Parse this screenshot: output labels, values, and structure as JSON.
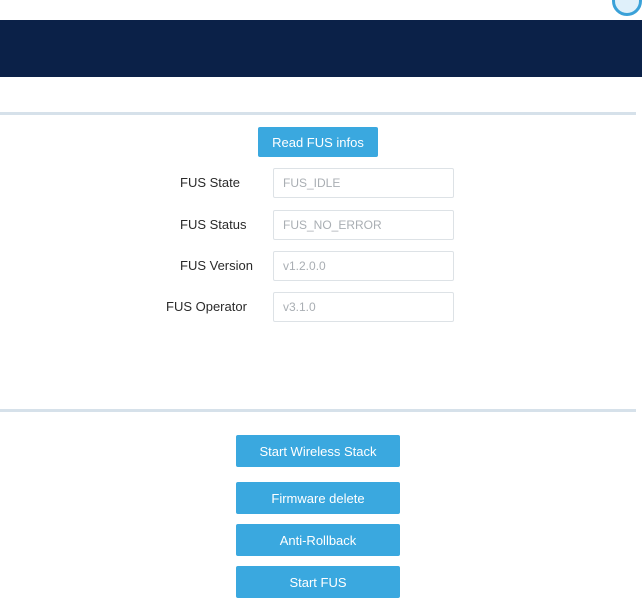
{
  "colors": {
    "header": "#0b2148",
    "button": "#3aa8df",
    "divider": "#d6e1ea",
    "field_text": "#a9aeb3"
  },
  "icons": {
    "corner": "app-logo-icon"
  },
  "fus_info": {
    "read_button": "Read FUS infos",
    "fields": [
      {
        "label": "FUS State",
        "value": "FUS_IDLE"
      },
      {
        "label": "FUS Status",
        "value": "FUS_NO_ERROR"
      },
      {
        "label": "FUS Version",
        "value": "v1.2.0.0"
      },
      {
        "label": "FUS Operator",
        "value": "v3.1.0"
      }
    ]
  },
  "actions": {
    "start_wireless_stack": "Start Wireless Stack",
    "firmware_delete": "Firmware delete",
    "anti_rollback": "Anti-Rollback",
    "start_fus": "Start FUS"
  }
}
